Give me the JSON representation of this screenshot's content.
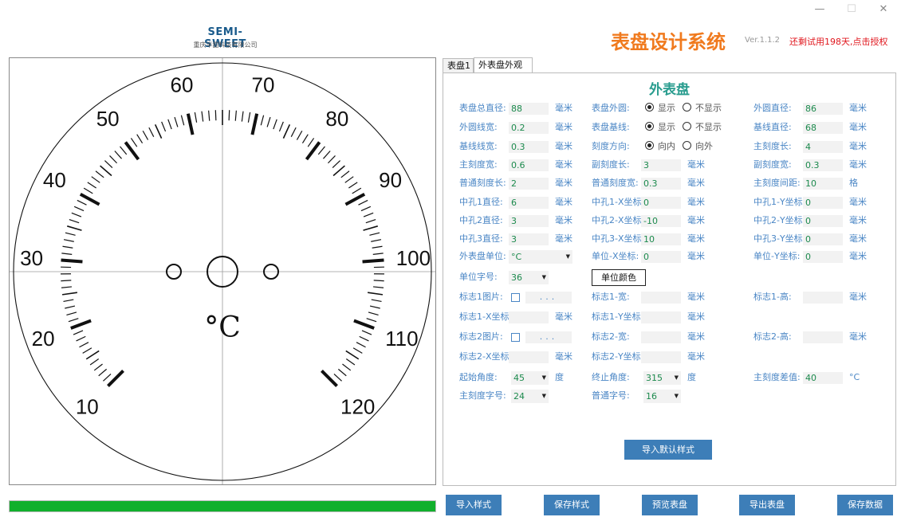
{
  "window_controls": {
    "minimize": "—",
    "maximize": "☐",
    "close": "✕"
  },
  "brand": {
    "name": "SEMI-SWEET",
    "company": "重庆半甜科技有限公司"
  },
  "app": {
    "title": "表盘设计系统",
    "version": "Ver.1.1.2",
    "license_notice": "还剩试用198天,点击授权"
  },
  "tabs": [
    {
      "label": "表盘1"
    },
    {
      "label": "外表盘外观"
    }
  ],
  "panel": {
    "title": "外表盘",
    "col1": [
      {
        "label": "表盘总直径:",
        "value": "88",
        "unit": "毫米"
      },
      {
        "label": "外圆线宽:",
        "value": "0.2",
        "unit": "毫米"
      },
      {
        "label": "基线线宽:",
        "value": "0.3",
        "unit": "毫米"
      },
      {
        "label": "主刻度宽:",
        "value": "0.6",
        "unit": "毫米"
      },
      {
        "label": "普通刻度长:",
        "value": "2",
        "unit": "毫米"
      },
      {
        "label": "中孔1直径:",
        "value": "6",
        "unit": "毫米"
      },
      {
        "label": "中孔2直径:",
        "value": "3",
        "unit": "毫米"
      },
      {
        "label": "中孔3直径:",
        "value": "3",
        "unit": "毫米"
      }
    ],
    "col2_radio": [
      {
        "label": "表盘外圆:",
        "opt1": "显示",
        "opt2": "不显示"
      },
      {
        "label": "表盘基线:",
        "opt1": "显示",
        "opt2": "不显示"
      },
      {
        "label": "刻度方向:",
        "opt1": "向内",
        "opt2": "向外"
      }
    ],
    "col2": [
      {
        "label": "副刻度长:",
        "value": "3",
        "unit": "毫米"
      },
      {
        "label": "普通刻度宽:",
        "value": "0.3",
        "unit": "毫米"
      },
      {
        "label": "中孔1-X坐标:",
        "value": "0",
        "unit": "毫米"
      },
      {
        "label": "中孔2-X坐标:",
        "value": "-10",
        "unit": "毫米"
      },
      {
        "label": "中孔3-X坐标:",
        "value": "10",
        "unit": "毫米"
      }
    ],
    "col3": [
      {
        "label": "外圆直径:",
        "value": "86",
        "unit": "毫米"
      },
      {
        "label": "基线直径:",
        "value": "68",
        "unit": "毫米"
      },
      {
        "label": "主刻度长:",
        "value": "4",
        "unit": "毫米"
      },
      {
        "label": "副刻度宽:",
        "value": "0.3",
        "unit": "毫米"
      },
      {
        "label": "主刻度间距:",
        "value": "10",
        "unit": "格"
      },
      {
        "label": "中孔1-Y坐标:",
        "value": "0",
        "unit": "毫米"
      },
      {
        "label": "中孔2-Y坐标:",
        "value": "0",
        "unit": "毫米"
      },
      {
        "label": "中孔3-Y坐标:",
        "value": "0",
        "unit": "毫米"
      }
    ],
    "unit_row": {
      "outer_unit_label": "外表盘单位:",
      "outer_unit_value": "°C",
      "unit_x_label": "单位-X坐标:",
      "unit_x_value": "0",
      "unit_x_unit": "毫米",
      "unit_y_label": "单位-Y坐标:",
      "unit_y_value": "0",
      "unit_y_unit": "毫米"
    },
    "font_row": {
      "label": "单位字号:",
      "value": "36",
      "color_button": "单位颜色"
    },
    "logo1": {
      "image_label": "标志1图片:",
      "browse": "...",
      "width_label": "标志1-宽:",
      "width_unit": "毫米",
      "height_label": "标志1-高:",
      "height_unit": "毫米",
      "x_label": "标志1-X坐标:",
      "x_unit": "毫米",
      "y_label": "标志1-Y坐标:",
      "y_unit": "毫米"
    },
    "logo2": {
      "image_label": "标志2图片:",
      "browse": "...",
      "width_label": "标志2-宽:",
      "width_unit": "毫米",
      "height_label": "标志2-高:",
      "height_unit": "毫米",
      "x_label": "标志2-X坐标:",
      "x_unit": "毫米",
      "y_label": "标志2-Y坐标:",
      "y_unit": "毫米"
    },
    "angles": {
      "start_label": "起始角度:",
      "start_value": "45",
      "start_unit": "度",
      "end_label": "终止角度:",
      "end_value": "315",
      "end_unit": "度",
      "diff_label": "主刻度差值:",
      "diff_value": "40",
      "diff_unit": "°C"
    },
    "fonts": {
      "major_label": "主刻度字号:",
      "major_value": "24",
      "normal_label": "普通字号:",
      "normal_value": "16"
    },
    "import_default": "导入默认样式"
  },
  "footer_buttons": {
    "import_style": "导入样式",
    "save_style": "保存样式",
    "preview": "预览表盘",
    "export": "导出表盘",
    "save_data": "保存数据"
  },
  "progress": {
    "percent": 100
  },
  "dial": {
    "labels": [
      "10",
      "20",
      "30",
      "40",
      "50",
      "60",
      "70",
      "80",
      "90",
      "100",
      "110",
      "120"
    ],
    "unit_text": "°C",
    "start_angle_deg": 45,
    "end_angle_deg": 315,
    "minor_per_major": 10
  },
  "colors": {
    "accent": "#3d7eb8",
    "title_orange": "#f07a1e",
    "teal": "#2a9d8f",
    "label_blue": "#4a86c5",
    "value_green": "#1c8a4d",
    "progress_green": "#11b02c",
    "warning_red": "#e0161d"
  }
}
